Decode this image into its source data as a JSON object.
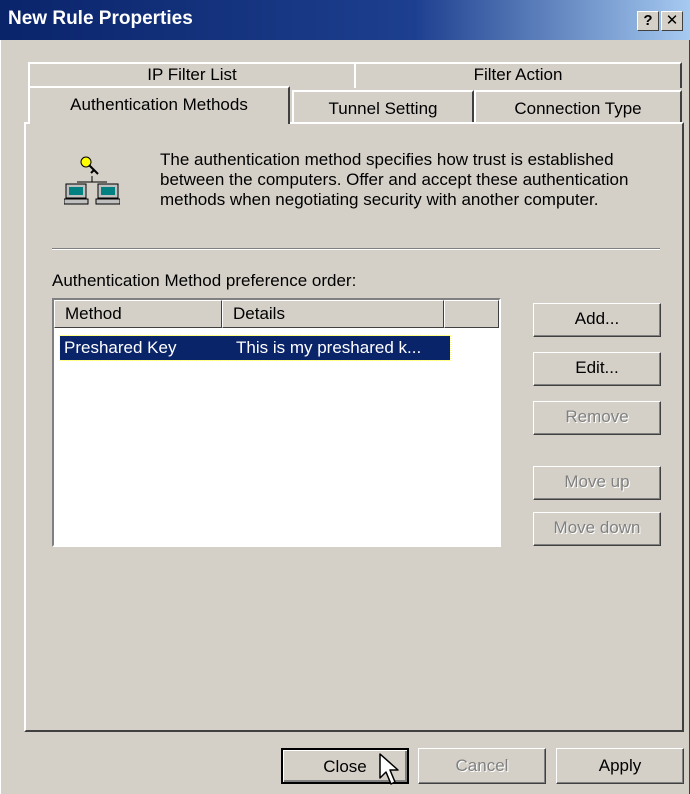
{
  "window": {
    "title": "New Rule Properties",
    "help_label": "?",
    "close_label": "✕"
  },
  "tabs": {
    "row1": [
      "IP Filter List",
      "Filter Action"
    ],
    "row2": [
      "Authentication Methods",
      "Tunnel Setting",
      "Connection Type"
    ],
    "active": "Authentication Methods"
  },
  "panel": {
    "intro": "The authentication method specifies how trust is established between the computers. Offer and accept these authentication methods when negotiating security with another computer.",
    "list_caption": "Authentication Method preference order:",
    "columns": [
      "Method",
      "Details"
    ],
    "rows": [
      {
        "method": "Preshared Key",
        "details": "This is my preshared k..."
      }
    ],
    "buttons": {
      "add": "Add...",
      "edit": "Edit...",
      "remove": "Remove",
      "move_up": "Move up",
      "move_down": "Move down"
    }
  },
  "footer": {
    "close": "Close",
    "cancel": "Cancel",
    "apply": "Apply"
  },
  "colors": {
    "title_bar": "#0a246a",
    "selection": "#0a246a",
    "face": "#d4d0c8"
  },
  "icons": {
    "network": "network-computers-key-icon",
    "cursor": "mouse-pointer-icon"
  }
}
